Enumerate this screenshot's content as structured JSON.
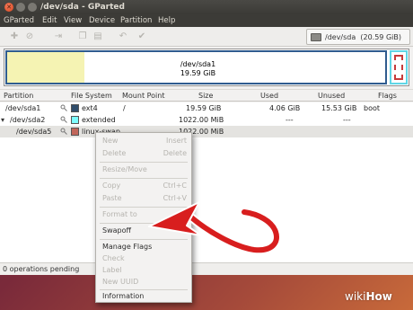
{
  "window": {
    "title": "/dev/sda - GParted"
  },
  "menubar": [
    "GParted",
    "Edit",
    "View",
    "Device",
    "Partition",
    "Help"
  ],
  "toolbar": {
    "device": "/dev/sda",
    "device_size": "(20.59 GiB)"
  },
  "graphic": {
    "partition_name": "/dev/sda1",
    "partition_size": "19.59 GiB"
  },
  "table": {
    "columns": [
      "Partition",
      "File System",
      "Mount Point",
      "Size",
      "Used",
      "Unused",
      "Flags"
    ],
    "rows": [
      {
        "partition": "/dev/sda1",
        "fs": "ext4",
        "fs_color": "#314e6c",
        "mount": "/",
        "size": "19.59 GiB",
        "used": "4.06 GiB",
        "unused": "15.53 GiB",
        "flags": "boot"
      },
      {
        "partition": "/dev/sda2",
        "fs": "extended",
        "fs_color": "#7dfcfe",
        "mount": "",
        "size": "1022.00 MiB",
        "used": "---",
        "unused": "---",
        "flags": ""
      },
      {
        "partition": "/dev/sda5",
        "fs": "linux-swap",
        "fs_color": "#c1665a",
        "mount": "",
        "size": "1022.00 MiB",
        "used": "",
        "unused": "",
        "flags": ""
      }
    ]
  },
  "context_menu": {
    "items": [
      {
        "label": "New",
        "shortcut": "Insert"
      },
      {
        "label": "Delete",
        "shortcut": "Delete"
      },
      {
        "label": "Resize/Move",
        "shortcut": ""
      },
      {
        "label": "Copy",
        "shortcut": "Ctrl+C"
      },
      {
        "label": "Paste",
        "shortcut": "Ctrl+V"
      },
      {
        "label": "Format to",
        "shortcut": ""
      },
      {
        "label": "Swapoff",
        "shortcut": ""
      },
      {
        "label": "Manage Flags",
        "shortcut": ""
      },
      {
        "label": "Check",
        "shortcut": ""
      },
      {
        "label": "Label",
        "shortcut": ""
      },
      {
        "label": "New UUID",
        "shortcut": ""
      },
      {
        "label": "Information",
        "shortcut": ""
      }
    ]
  },
  "status": {
    "text": "0 operations pending"
  },
  "watermark": {
    "part1": "wiki",
    "part2": "How"
  }
}
